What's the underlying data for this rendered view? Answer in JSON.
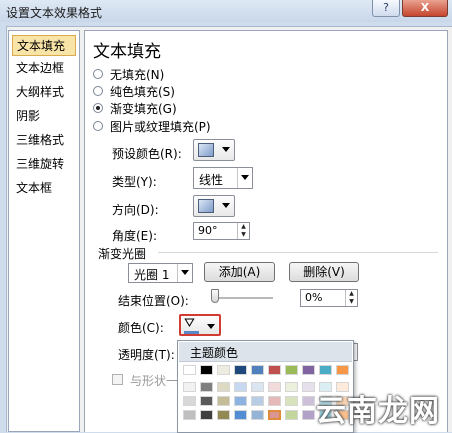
{
  "window": {
    "title": "设置文本效果格式",
    "help_glyph": "?",
    "close_glyph": "X"
  },
  "sidebar": {
    "items": [
      {
        "label": "文本填充",
        "selected": true
      },
      {
        "label": "文本边框"
      },
      {
        "label": "大纲样式"
      },
      {
        "label": "阴影"
      },
      {
        "label": "三维格式"
      },
      {
        "label": "三维旋转"
      },
      {
        "label": "文本框"
      }
    ]
  },
  "panel": {
    "heading": "文本填充",
    "fill_options": [
      {
        "label": "无填充(N)",
        "checked": false
      },
      {
        "label": "纯色填充(S)",
        "checked": false
      },
      {
        "label": "渐变填充(G)",
        "checked": true
      },
      {
        "label": "图片或纹理填充(P)",
        "checked": false
      }
    ],
    "preset_colors_label": "预设颜色(R):",
    "type_label": "类型(Y):",
    "type_value": "线性",
    "direction_label": "方向(D):",
    "angle_label": "角度(E):",
    "angle_value": "90°",
    "gradient_stops_label": "渐变光圈",
    "stop_select_value": "光圈 1",
    "add_button": "添加(A)",
    "delete_button": "删除(V)",
    "end_position_label": "结束位置(O):",
    "end_position_value": "0%",
    "end_position_slider": 0,
    "color_label": "颜色(C):",
    "transparency_label": "透明度(T):",
    "rotate_with_shape_label": "与形状一"
  },
  "color_popup": {
    "header": "主题颜色",
    "top_row": [
      "#ffffff",
      "#000000",
      "#eeece1",
      "#1f497d",
      "#4f81bd",
      "#c0504d",
      "#9bbb59",
      "#8064a2",
      "#4bacc6",
      "#f79646"
    ],
    "rows": [
      [
        "#f2f2f2",
        "#7f7f7f",
        "#ddd9c3",
        "#c6d9f0",
        "#dbe5f1",
        "#f2dcdb",
        "#ebf1dd",
        "#e5e0ec",
        "#dbeef3",
        "#fdeada"
      ],
      [
        "#d8d8d8",
        "#595959",
        "#c4bd97",
        "#8db3e2",
        "#b8cce4",
        "#e5b9b7",
        "#d7e3bc",
        "#ccc1d9",
        "#b7dde8",
        "#fbd5b5"
      ],
      [
        "#bfbfbf",
        "#3f3f3f",
        "#938953",
        "#548dd4",
        "#95b3d7",
        "#d99694",
        "#c3d69b",
        "#b2a2c7",
        "#92cddc",
        "#fac08f"
      ]
    ],
    "selected": {
      "row": 2,
      "col": 5
    }
  },
  "watermark": "云南龙网"
}
